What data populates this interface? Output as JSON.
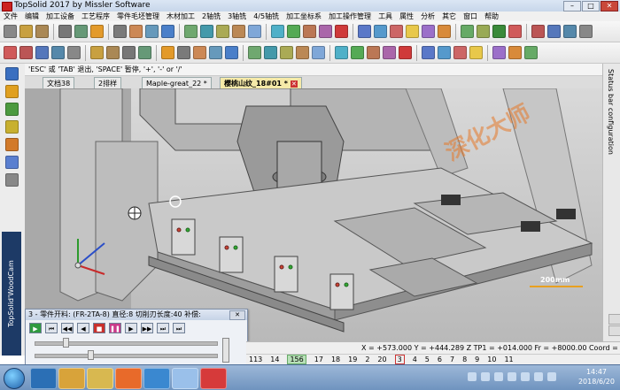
{
  "window": {
    "title": "TopSolid 2017 by Missler Software"
  },
  "menu": [
    "文件",
    "编辑",
    "加工设备",
    "工艺程序",
    "零件毛坯管理",
    "木材加工",
    "2轴铣",
    "3轴铣",
    "4/5轴铣",
    "加工坐标系",
    "加工操作管理",
    "工具",
    "属性",
    "分析",
    "其它",
    "窗口",
    "帮助"
  ],
  "hint": "'ESC' 或 'TAB' 退出, 'SPACE' 暂停, '+', '-' or '/'",
  "tabs": [
    {
      "label": "文档38"
    },
    {
      "label": "2排样"
    },
    {
      "label": "Maple-great_22 *"
    },
    {
      "label": "樱桃山纹_18#01 *"
    }
  ],
  "side_panel": {
    "label": "Status bar configuration"
  },
  "viewport": {
    "scale_label": "200mm",
    "watermark": "深化大师"
  },
  "left_toolbar": {
    "brand": "TopSolid'WoodCam"
  },
  "dialog": {
    "title": "3 - 零件开料:   (FR-2TA-8)  直径:8  切削刃长度:40  补偿:",
    "buttons": [
      "▶",
      "⏮",
      "◀◀",
      "◀",
      "■",
      "❚❚",
      "▶",
      "▶▶",
      "⏭",
      "⏭"
    ]
  },
  "status": {
    "coords": "X = +573.000  Y = +444.289  Z TP1 = +014.000  Fr = +8000.00  Coord = 加工坐标"
  },
  "pages": [
    "113",
    "14",
    "156",
    "17",
    "18",
    "19",
    "2",
    "20",
    "3",
    "4",
    "5",
    "6",
    "7",
    "8",
    "9",
    "10",
    "11"
  ],
  "pages_highlight": "156",
  "pages_current": "3",
  "taskbar": {
    "time": "14:47",
    "date": "2018/6/20"
  }
}
